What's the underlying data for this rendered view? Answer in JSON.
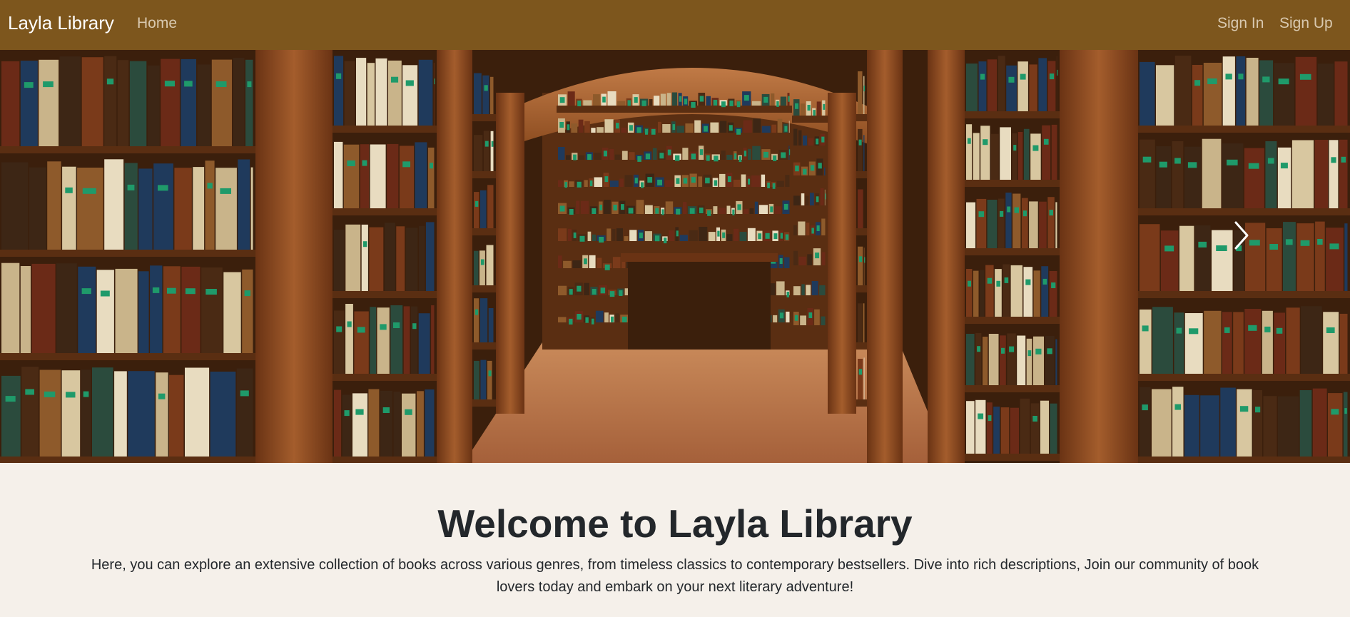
{
  "navbar": {
    "brand": "Layla Library",
    "home": "Home",
    "sign_in": "Sign In",
    "sign_up": "Sign Up",
    "background": "#7d561d"
  },
  "carousel": {
    "image_alt": "Library interior with wooden bookshelves",
    "next_icon": "chevron-right-icon"
  },
  "welcome": {
    "title": "Welcome to Layla Library",
    "text": "Here, you can explore an extensive collection of books across various genres, from timeless classics to contemporary bestsellers. Dive into rich descriptions, Join our community of book lovers today and embark on your next literary adventure!"
  },
  "colors": {
    "page_background": "#f5f0ea",
    "wood": "#8a4a1e",
    "text": "#23272b"
  }
}
